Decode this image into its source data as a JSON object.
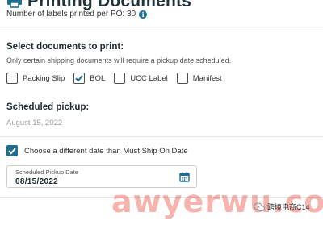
{
  "header": {
    "title": "Printing Documents",
    "subtitle": "Number of labels printed per PO: 30",
    "title_icon": "printer-icon",
    "info_icon": "info-icon"
  },
  "documents": {
    "heading": "Select documents to print:",
    "help": "Only certain shipping documents will require a pickup date scheduled.",
    "options": [
      {
        "label": "Packing Slip",
        "checked": false
      },
      {
        "label": "BOL",
        "checked": true
      },
      {
        "label": "UCC Label",
        "checked": false
      },
      {
        "label": "Manifest",
        "checked": false
      }
    ]
  },
  "pickup": {
    "heading": "Scheduled pickup:",
    "date": "August 15, 2022",
    "different_date_label": "Choose a different date than Must Ship On Date",
    "different_date_checked": true,
    "field_label": "Scheduled Pickup Date",
    "field_value": "08/15/2022",
    "calendar_icon": "calendar-icon"
  },
  "watermark": {
    "text": "awyerwu.com",
    "wechat_text": "跨境电商C14"
  },
  "colors": {
    "accent": "#1f6e8f",
    "text": "#1f2a2e",
    "muted": "#9aa0a4",
    "watermark": "#e74c3c"
  }
}
